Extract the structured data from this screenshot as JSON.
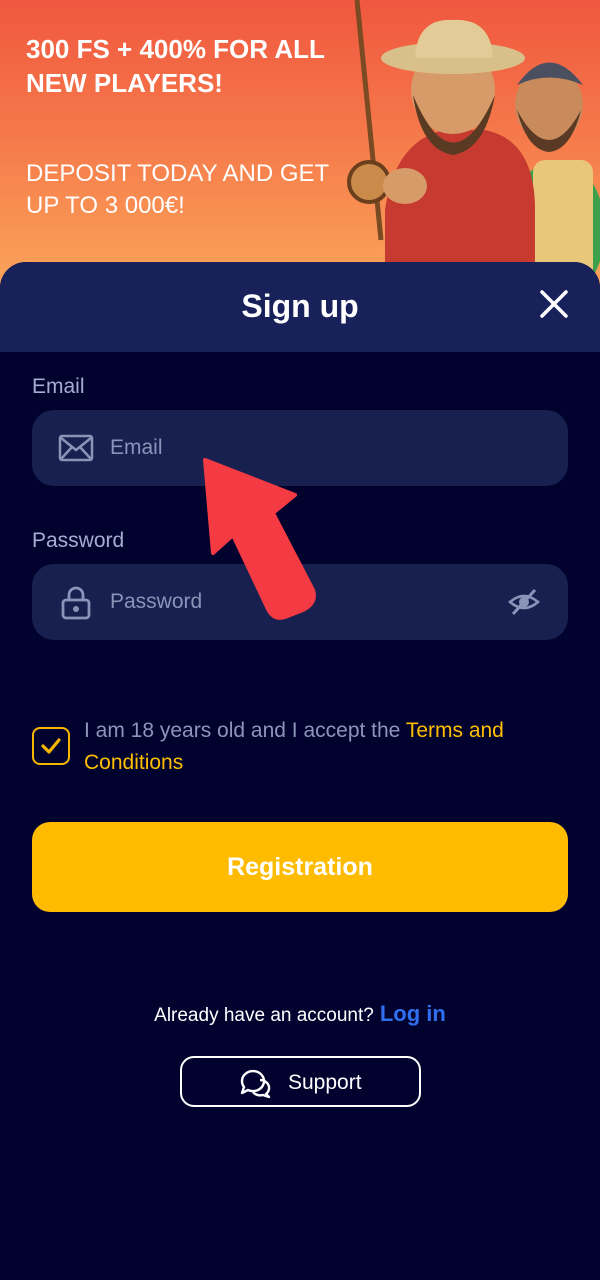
{
  "banner": {
    "title": "300 FS + 400% FOR ALL NEW PLAYERS!",
    "subtitle": "DEPOSIT TODAY AND GET UP TO 3 000€!"
  },
  "modal": {
    "title": "Sign up",
    "close_icon": "close-icon"
  },
  "email": {
    "label": "Email",
    "placeholder": "Email",
    "icon": "envelope-icon"
  },
  "password": {
    "label": "Password",
    "placeholder": "Password",
    "icon": "lock-icon",
    "toggle_icon": "eye-slash-icon"
  },
  "terms": {
    "checked": true,
    "text": "I am 18 years old and I accept the ",
    "link": "Terms and Conditions"
  },
  "register": {
    "label": "Registration"
  },
  "footer": {
    "account_text": "Already have an account?",
    "login_link": "Log in",
    "support_label": "Support",
    "support_icon": "chat-bubbles-icon"
  },
  "colors": {
    "accent": "#ffbb00",
    "background": "#02022e",
    "field": "#17204f",
    "header": "#18215a",
    "link": "#2f6ff0",
    "arrow": "#f43a42"
  }
}
